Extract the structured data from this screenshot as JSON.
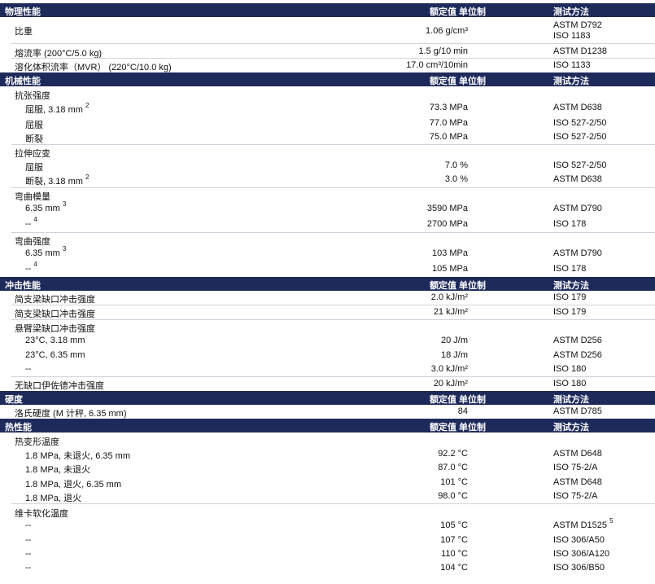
{
  "sections": [
    {
      "title": "物理性能",
      "value_header": "额定值 单位制",
      "method_header": "测试方法",
      "rows": [
        {
          "label": "比重",
          "value": "1.06 g/cm³",
          "method": "ASTM D792",
          "method2": "ISO 1183"
        },
        {
          "label": "熔流率 (200°C/5.0 kg)",
          "value": "1.5 g/10 min",
          "method": "ASTM D1238"
        },
        {
          "label": "溶化体积流率（MVR） (220°C/10.0 kg)",
          "value": "17.0 cm³/10min",
          "method": "ISO 1133"
        }
      ]
    },
    {
      "title": "机械性能",
      "value_header": "额定值 单位制",
      "method_header": "测试方法",
      "groups": [
        {
          "label": "抗张强度",
          "rows": [
            {
              "label": "屈服, 3.18 mm",
              "sup": "2",
              "value": "73.3 MPa",
              "method": "ASTM D638"
            },
            {
              "label": "屈服",
              "value": "77.0 MPa",
              "method": "ISO 527-2/50"
            },
            {
              "label": "断裂",
              "value": "75.0 MPa",
              "method": "ISO 527-2/50"
            }
          ]
        },
        {
          "label": "拉伸应变",
          "rows": [
            {
              "label": "屈服",
              "value": "7.0 %",
              "method": "ISO 527-2/50"
            },
            {
              "label": "断裂, 3.18 mm",
              "sup": "2",
              "value": "3.0 %",
              "method": "ASTM D638"
            }
          ]
        },
        {
          "label": "弯曲模量",
          "rows": [
            {
              "label": "6.35 mm",
              "sup": "3",
              "value": "3590 MPa",
              "method": "ASTM D790"
            },
            {
              "label": "--",
              "sup": "4",
              "value": "2700 MPa",
              "method": "ISO 178"
            }
          ]
        },
        {
          "label": "弯曲强度",
          "rows": [
            {
              "label": "6.35 mm",
              "sup": "3",
              "value": "103 MPa",
              "method": "ASTM D790"
            },
            {
              "label": "--",
              "sup": "4",
              "value": "105 MPa",
              "method": "ISO 178"
            }
          ]
        }
      ]
    },
    {
      "title": "冲击性能",
      "value_header": "额定值 单位制",
      "method_header": "测试方法",
      "rows": [
        {
          "label": "简支梁缺口冲击强度",
          "value": "2.0 kJ/m²",
          "method": "ISO 179"
        },
        {
          "label": "简支梁缺口冲击强度",
          "value": "21 kJ/m²",
          "method": "ISO 179"
        }
      ],
      "group": {
        "label": "悬臂梁缺口冲击强度",
        "rows": [
          {
            "label": "23°C, 3.18 mm",
            "value": "20 J/m",
            "method": "ASTM D256"
          },
          {
            "label": "23°C, 6.35 mm",
            "value": "18 J/m",
            "method": "ASTM D256"
          },
          {
            "label": "--",
            "value": "3.0 kJ/m²",
            "method": "ISO 180"
          }
        ]
      },
      "last_row": {
        "label": "无缺口伊佐德冲击强度",
        "value": "20 kJ/m²",
        "method": "ISO 180"
      }
    },
    {
      "title": "硬度",
      "value_header": "额定值 单位制",
      "method_header": "测试方法",
      "rows": [
        {
          "label": "洛氏硬度 (M 计秤, 6.35 mm)",
          "value": "84",
          "method": "ASTM D785"
        }
      ]
    },
    {
      "title": "热性能",
      "value_header": "额定值 单位制",
      "method_header": "测试方法",
      "groups": [
        {
          "label": "热变形温度",
          "rows": [
            {
              "label": "1.8 MPa, 未退火, 6.35 mm",
              "value": "92.2 °C",
              "method": "ASTM D648"
            },
            {
              "label": "1.8 MPa, 未退火",
              "value": "87.0 °C",
              "method": "ISO 75-2/A"
            },
            {
              "label": "1.8 MPa, 退火, 6.35 mm",
              "value": "101 °C",
              "method": "ASTM D648"
            },
            {
              "label": "1.8 MPa, 退火",
              "value": "98.0 °C",
              "method": "ISO 75-2/A"
            }
          ]
        },
        {
          "label": "维卡软化温度",
          "rows": [
            {
              "label": "--",
              "value": "105 °C",
              "method": "ASTM D1525",
              "method_sup": "5"
            },
            {
              "label": "--",
              "value": "107 °C",
              "method": "ISO 306/A50"
            },
            {
              "label": "--",
              "value": "110 °C",
              "method": "ISO 306/A120"
            },
            {
              "label": "--",
              "value": "104 °C",
              "method": "ISO 306/B50"
            }
          ]
        }
      ]
    }
  ]
}
